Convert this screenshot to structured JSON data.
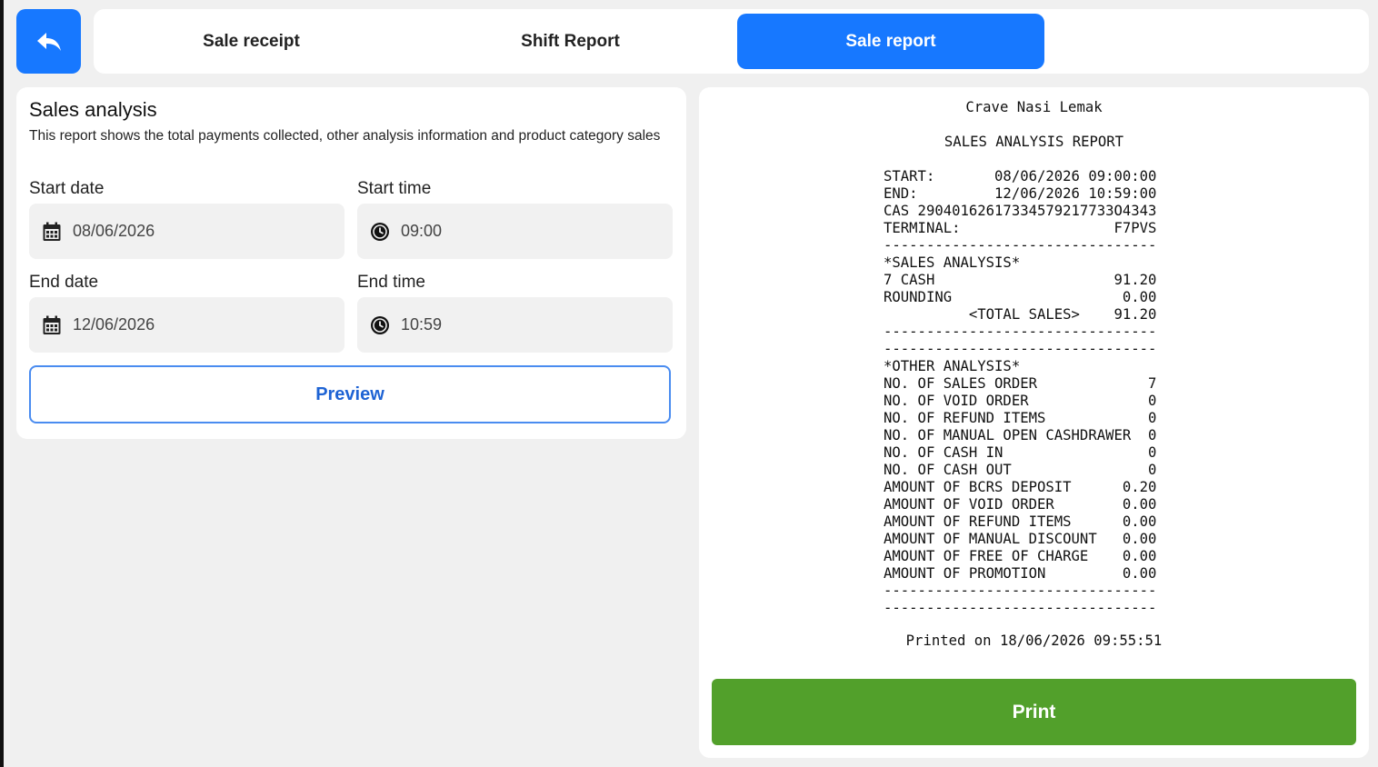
{
  "tabs": [
    {
      "label": "Sale receipt",
      "active": false
    },
    {
      "label": "Shift Report",
      "active": false
    },
    {
      "label": "Sale report",
      "active": true
    }
  ],
  "form": {
    "title": "Sales analysis",
    "description": "This report shows the total payments collected, other analysis information and product category sales",
    "start_date_label": "Start date",
    "start_date_value": "08/06/2026",
    "start_time_label": "Start time",
    "start_time_value": "09:00",
    "end_date_label": "End date",
    "end_date_value": "12/06/2026",
    "end_time_label": "End time",
    "end_time_value": "10:59",
    "preview_label": "Preview"
  },
  "receipt": {
    "store_name": "Crave Nasi Lemak",
    "report_title": "SALES ANALYSIS REPORT",
    "lines": [
      "START:       08/06/2026 09:00:00",
      "END:         12/06/2026 10:59:00",
      "CAS 29040162617334579217733O4343",
      "TERMINAL:                  F7PVS",
      "--------------------------------",
      "*SALES ANALYSIS*",
      "7 CASH                     91.20",
      "ROUNDING                    0.00",
      "          <TOTAL SALES>    91.20",
      "--------------------------------",
      "--------------------------------",
      "*OTHER ANALYSIS*",
      "NO. OF SALES ORDER             7",
      "NO. OF VOID ORDER              0",
      "NO. OF REFUND ITEMS            0",
      "NO. OF MANUAL OPEN CASHDRAWER  0",
      "NO. OF CASH IN                 0",
      "NO. OF CASH OUT                0",
      "AMOUNT OF BCRS DEPOSIT      0.20",
      "AMOUNT OF VOID ORDER        0.00",
      "AMOUNT OF REFUND ITEMS      0.00",
      "AMOUNT OF MANUAL DISCOUNT   0.00",
      "AMOUNT OF FREE OF CHARGE    0.00",
      "AMOUNT OF PROMOTION         0.00",
      "--------------------------------",
      "--------------------------------"
    ],
    "printed_on": "Printed on 18/06/2026 09:55:51"
  },
  "print_label": "Print",
  "colors": {
    "accent": "#1778ff",
    "print": "#52a02b",
    "preview_border": "#4a8cf0"
  },
  "icons": {
    "back": "reply-arrow-icon",
    "date": "calendar-icon",
    "time": "clock-icon"
  }
}
